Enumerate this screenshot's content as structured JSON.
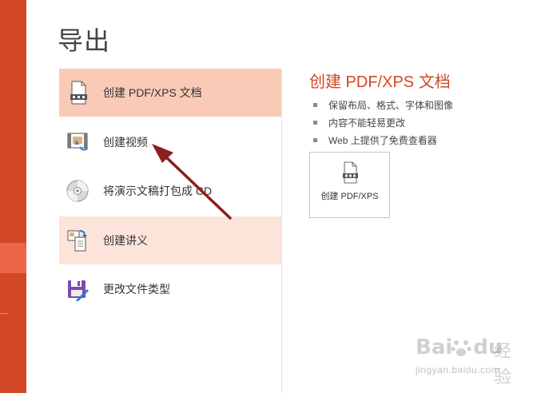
{
  "page": {
    "title": "导出"
  },
  "export_options": [
    {
      "label": "创建 PDF/XPS 文档",
      "icon": "pdf-doc-icon"
    },
    {
      "label": "创建视频",
      "icon": "video-icon"
    },
    {
      "label": "将演示文稿打包成 CD",
      "icon": "cd-icon"
    },
    {
      "label": "创建讲义",
      "icon": "handout-icon"
    },
    {
      "label": "更改文件类型",
      "icon": "save-filetype-icon"
    }
  ],
  "detail": {
    "title": "创建 PDF/XPS 文档",
    "bullets": [
      "保留布局、格式、字体和图像",
      "内容不能轻易更改",
      "Web 上提供了免费查看器"
    ],
    "button_label": "创建 PDF/XPS"
  },
  "watermark": {
    "logo": "Bai",
    "logo_suffix": "du",
    "text": "经验",
    "url": "jingyan.baidu.com"
  },
  "colors": {
    "accent": "#d24726",
    "selected": "#f9cbb7",
    "hover": "#fce4da"
  }
}
